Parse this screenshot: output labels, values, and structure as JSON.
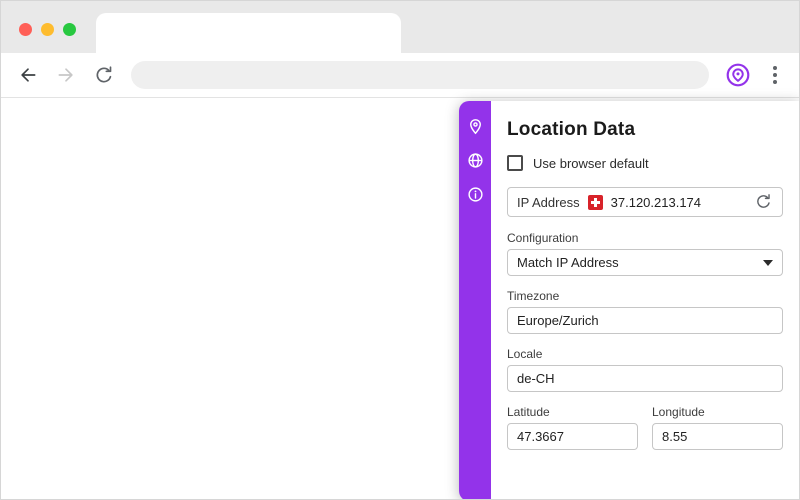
{
  "colors": {
    "accent": "#9333ea",
    "traffic_close": "#ff5f57",
    "traffic_min": "#febc2e",
    "traffic_max": "#28c840",
    "flag_red": "#d8232a"
  },
  "browser": {
    "tab_title": "",
    "address_value": ""
  },
  "popup": {
    "title": "Location Data",
    "use_default_label": "Use browser default",
    "ip": {
      "label": "IP Address",
      "value": "37.120.213.174",
      "country": "CH"
    },
    "configuration": {
      "label": "Configuration",
      "value": "Match IP Address"
    },
    "timezone": {
      "label": "Timezone",
      "value": "Europe/Zurich"
    },
    "locale": {
      "label": "Locale",
      "value": "de-CH"
    },
    "latitude": {
      "label": "Latitude",
      "value": "47.3667"
    },
    "longitude": {
      "label": "Longitude",
      "value": "8.55"
    }
  }
}
